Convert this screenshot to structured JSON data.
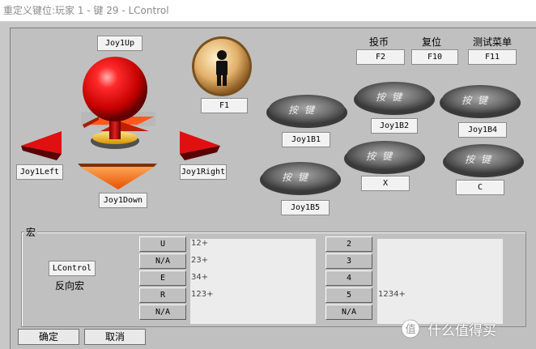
{
  "window": {
    "title": "重定义键位:玩家 1 - 键 29 - LControl"
  },
  "joystick": {
    "up": "Joy1Up",
    "down": "Joy1Down",
    "left": "Joy1Left",
    "right": "Joy1Right"
  },
  "player_button": {
    "label": "F1"
  },
  "top_buttons": [
    {
      "caption": "投币",
      "key": "F2"
    },
    {
      "caption": "复位",
      "key": "F10"
    },
    {
      "caption": "测试菜单",
      "key": "F11"
    }
  ],
  "action_buttons": [
    {
      "label": "Joy1B1"
    },
    {
      "label": "Joy1B2"
    },
    {
      "label": "Joy1B4"
    },
    {
      "label": "X"
    },
    {
      "label": "C"
    },
    {
      "label": "Joy1B5"
    }
  ],
  "pad_glyph": "按键",
  "macro": {
    "title": "宏",
    "key": "LControl",
    "reverse_label": "反向宏",
    "left_buttons": [
      "U",
      "N/A",
      "E",
      "R",
      "N/A"
    ],
    "left_lines": [
      "12+",
      "23+",
      "34+",
      "123+"
    ],
    "right_buttons": [
      "2",
      "3",
      "4",
      "5",
      "N/A"
    ],
    "right_lines": [
      "1234+"
    ]
  },
  "footer": {
    "ok": "确定",
    "cancel": "取消"
  },
  "watermark": {
    "icon": "zhi-icon",
    "text": "什么值得买"
  }
}
